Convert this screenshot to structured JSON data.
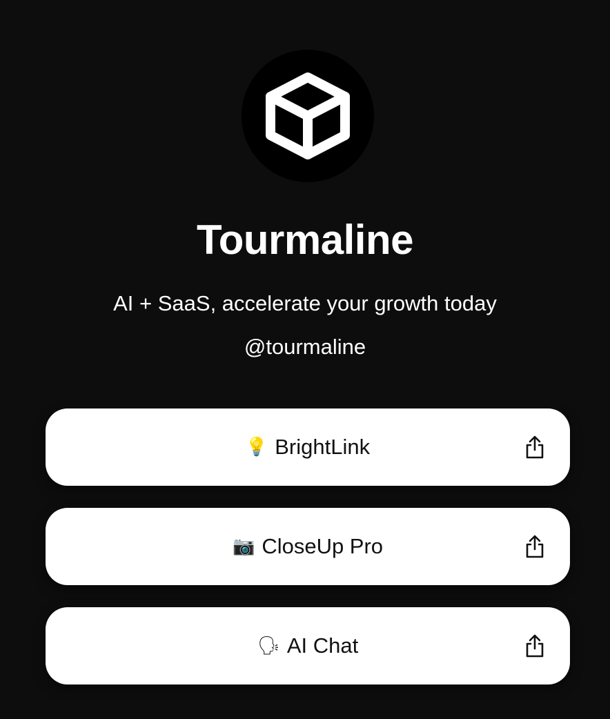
{
  "profile": {
    "avatar_icon": "cube-icon",
    "name": "Tourmaline",
    "tagline": "AI + SaaS, accelerate your growth today",
    "handle": "@tourmaline"
  },
  "links": [
    {
      "emoji": "💡",
      "icon": "lightbulb-icon",
      "label": "BrightLink",
      "action_icon": "share-icon"
    },
    {
      "emoji": "📷",
      "icon": "camera-icon",
      "label": "CloseUp Pro",
      "action_icon": "share-icon"
    },
    {
      "emoji": "🗣",
      "icon": "speaking-head-icon",
      "label": "AI Chat",
      "action_icon": "share-icon"
    }
  ],
  "colors": {
    "background": "#0d0d0d",
    "avatar_background": "#000000",
    "text": "#ffffff",
    "card_background": "#ffffff",
    "card_text": "#111111"
  }
}
